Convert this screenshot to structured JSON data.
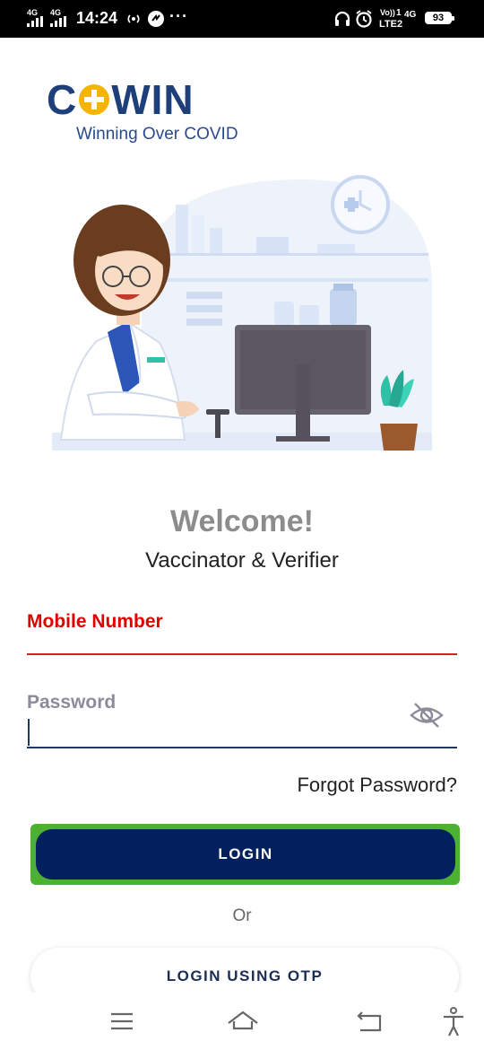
{
  "status_bar": {
    "network_1": "4G",
    "network_2": "4G",
    "time": "14:24",
    "more": "···",
    "volte": "Vo))",
    "sim": "1",
    "lte": "LTE2",
    "network_3": "4G",
    "battery": "93",
    "icons": [
      "hotspot-icon",
      "data-saver-icon",
      "headphones-icon",
      "alarm-icon"
    ]
  },
  "logo": {
    "word_left": "C",
    "word_right": "WIN",
    "tagline": "Winning Over COVID",
    "colors": {
      "text": "#1d3f7a",
      "plus": "#f4b400"
    }
  },
  "welcome": {
    "title": "Welcome!",
    "subtitle": "Vaccinator & Verifier"
  },
  "form": {
    "mobile_label": "Mobile Number",
    "password_label": "Password",
    "forgot_password": "Forgot Password?",
    "login_label": "LOGIN",
    "or_text": "Or",
    "otp_label": "LOGIN USING OTP"
  },
  "colors": {
    "error_red": "#e00000",
    "primary_navy": "#03205e",
    "focus_green": "#4cb030"
  },
  "nav_bar": {
    "icons": [
      "menu-icon",
      "home-icon",
      "back-icon",
      "accessibility-icon"
    ]
  }
}
